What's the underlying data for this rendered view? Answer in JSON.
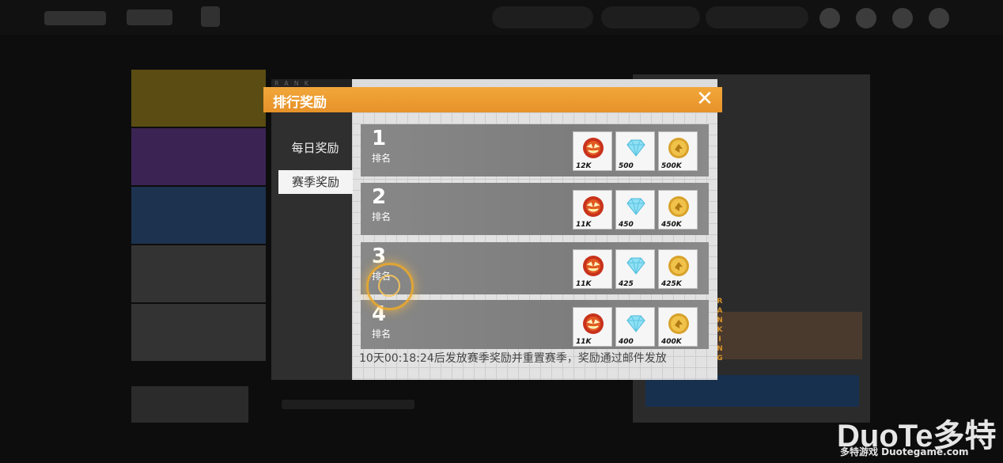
{
  "dialog": {
    "title": "排行奖励",
    "close_glyph": "✕",
    "tabs": [
      {
        "label": "每日奖励",
        "selected": false
      },
      {
        "label": "赛季奖励",
        "selected": true
      }
    ],
    "rank_label": "排名",
    "rows": [
      {
        "rank": "1",
        "rewards": [
          {
            "icon": "pumpkin-icon",
            "amount": "12K"
          },
          {
            "icon": "diamond-icon",
            "amount": "500"
          },
          {
            "icon": "gold-coin-icon",
            "amount": "500K"
          }
        ]
      },
      {
        "rank": "2",
        "rewards": [
          {
            "icon": "pumpkin-icon",
            "amount": "11K"
          },
          {
            "icon": "diamond-icon",
            "amount": "450"
          },
          {
            "icon": "gold-coin-icon",
            "amount": "450K"
          }
        ]
      },
      {
        "rank": "3",
        "rewards": [
          {
            "icon": "pumpkin-icon",
            "amount": "11K"
          },
          {
            "icon": "diamond-icon",
            "amount": "425"
          },
          {
            "icon": "gold-coin-icon",
            "amount": "425K"
          }
        ]
      },
      {
        "rank": "4",
        "rewards": [
          {
            "icon": "pumpkin-icon",
            "amount": "11K"
          },
          {
            "icon": "diamond-icon",
            "amount": "400"
          },
          {
            "icon": "gold-coin-icon",
            "amount": "400K"
          }
        ]
      }
    ],
    "footer": "10天00:18:24后发放赛季奖励并重置赛季，奖励通过邮件发放",
    "deco_rank": "RANK",
    "deco_ranking": "RANKING"
  },
  "watermark": {
    "brand": "DuoTe多特",
    "sub": "多特游戏 Duotegame.com"
  },
  "colors": {
    "accent": "#e6922a",
    "row_bg": "#808080"
  }
}
